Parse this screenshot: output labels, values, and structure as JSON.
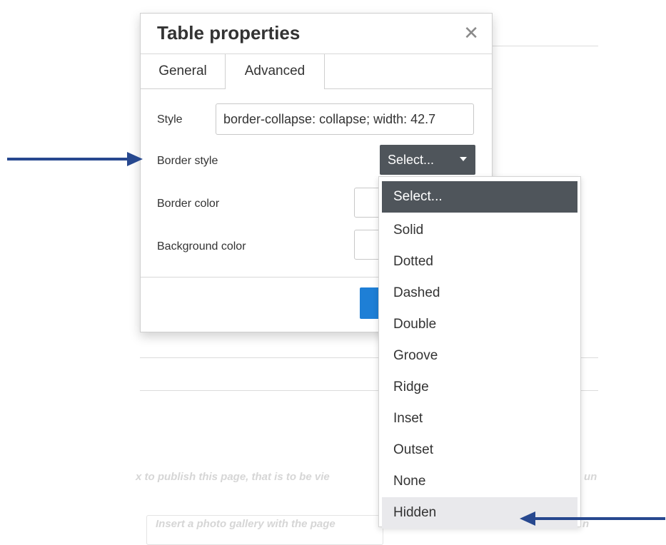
{
  "background": {
    "publish_text": "x to publish this page, that is to be vie",
    "publish_text_tail": "un",
    "gallery_text": "Insert a photo gallery with the page",
    "gallery_tail": "n"
  },
  "dialog": {
    "title": "Table properties",
    "close_icon": "close-icon",
    "tabs": [
      {
        "label": "General",
        "active": false
      },
      {
        "label": "Advanced",
        "active": true
      }
    ],
    "fields": {
      "style_label": "Style",
      "style_value": "border-collapse: collapse; width: 42.7",
      "border_style_label": "Border style",
      "border_style_selected": "Select...",
      "border_color_label": "Border color",
      "background_color_label": "Background color"
    }
  },
  "dropdown": {
    "options": [
      "Select...",
      "Solid",
      "Dotted",
      "Dashed",
      "Double",
      "Groove",
      "Ridge",
      "Inset",
      "Outset",
      "None",
      "Hidden"
    ],
    "selected": "Select...",
    "hovered": "Hidden"
  },
  "colors": {
    "select_bg": "#4f555b",
    "primary_button": "#1e7fd6",
    "annotation_arrow": "#27488f"
  }
}
